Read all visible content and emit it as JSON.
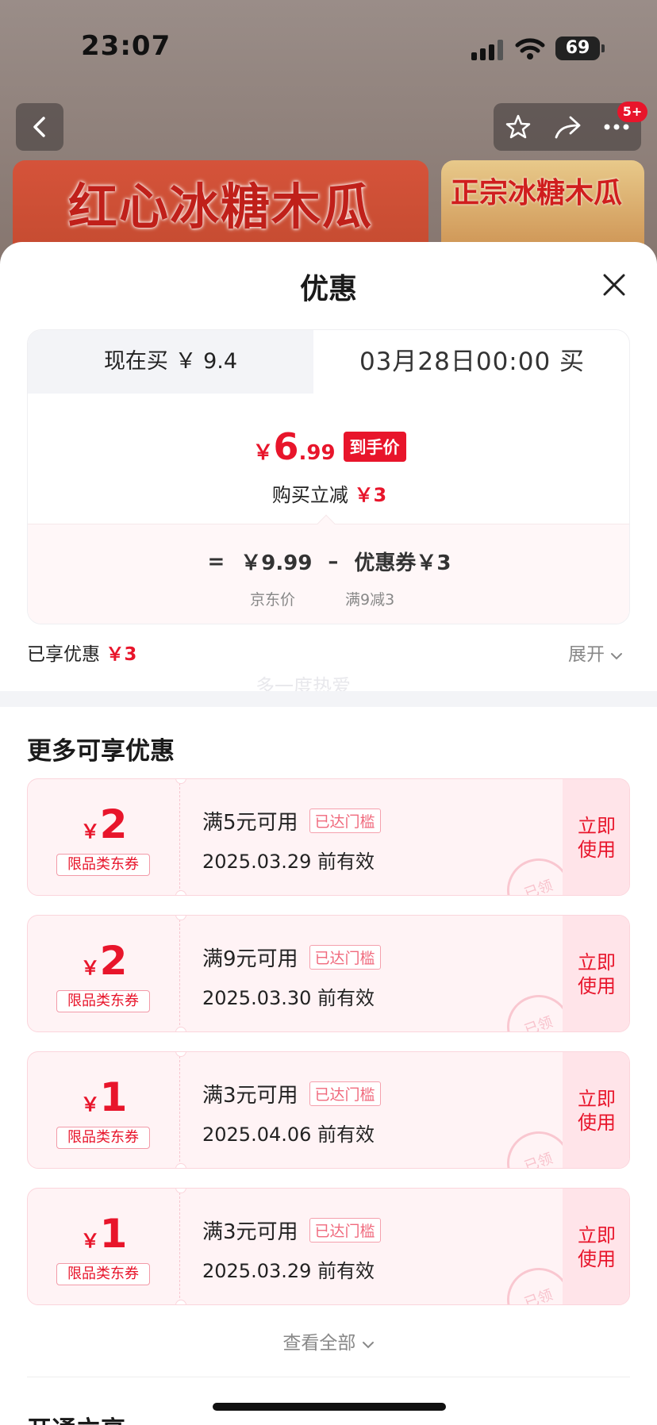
{
  "status": {
    "time": "23:07",
    "battery": "69"
  },
  "header": {
    "badge": "5+"
  },
  "banners": {
    "left_text": "红心冰糖木瓜",
    "right_text": "正宗冰糖木瓜"
  },
  "sheet": {
    "title": "优惠",
    "tabs": {
      "now_label": "现在买 ￥ 9.4",
      "later_label": "03月28日00:00 买"
    },
    "price": {
      "yen": "￥",
      "int": "6",
      "dec": ".99",
      "tag": "到手价"
    },
    "save": {
      "label": "购买立减 ",
      "value": "￥3"
    },
    "breakdown": {
      "eq": "=",
      "jd_price": "￥9.99",
      "minus": "–",
      "coupon": "优惠券￥3",
      "jd_label": "京东价",
      "coupon_label": "满9减3"
    },
    "enjoyed": {
      "label": "已享优惠 ",
      "value": "￥3"
    },
    "expand": "展开",
    "watermark": "多一度热爱",
    "more_title": "更多可享优惠",
    "coupons": [
      {
        "yen": "￥",
        "amount": "2",
        "tag": "限品类东券",
        "cond": "满5元可用",
        "reached": "已达门槛",
        "valid": "2025.03.29 前有效",
        "stamp": "已领",
        "use1": "立即",
        "use2": "使用"
      },
      {
        "yen": "￥",
        "amount": "2",
        "tag": "限品类东券",
        "cond": "满9元可用",
        "reached": "已达门槛",
        "valid": "2025.03.30 前有效",
        "stamp": "已领",
        "use1": "立即",
        "use2": "使用"
      },
      {
        "yen": "￥",
        "amount": "1",
        "tag": "限品类东券",
        "cond": "满3元可用",
        "reached": "已达门槛",
        "valid": "2025.04.06 前有效",
        "stamp": "已领",
        "use1": "立即",
        "use2": "使用"
      },
      {
        "yen": "￥",
        "amount": "1",
        "tag": "限品类东券",
        "cond": "满3元可用",
        "reached": "已达门槛",
        "valid": "2025.03.29 前有效",
        "stamp": "已领",
        "use1": "立即",
        "use2": "使用"
      }
    ],
    "see_all": "查看全部",
    "section2": "开通立享"
  },
  "colors": {
    "accent": "#e8152b",
    "coupon_bg": "#fff3f5"
  }
}
